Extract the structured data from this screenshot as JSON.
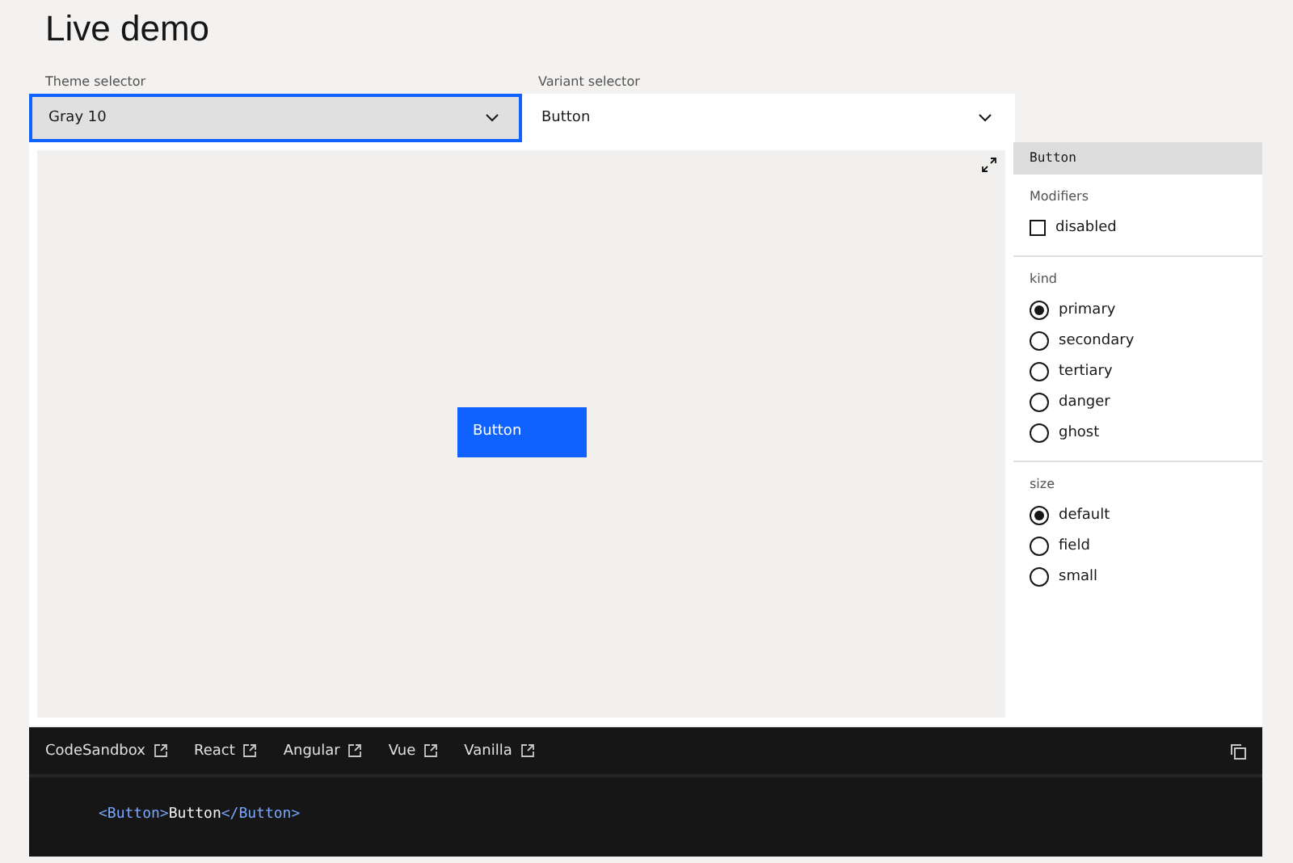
{
  "title": "Live demo",
  "theme_selector": {
    "label": "Theme selector",
    "value": "Gray 10",
    "focused": true
  },
  "variant_selector": {
    "label": "Variant selector",
    "value": "Button",
    "focused": false
  },
  "preview": {
    "button_label": "Button"
  },
  "knobs": {
    "title": "Button",
    "groups": [
      {
        "kind": "checkbox",
        "label": "Modifiers",
        "options": [
          {
            "label": "disabled",
            "checked": false
          }
        ]
      },
      {
        "kind": "radio",
        "label": "kind",
        "options": [
          {
            "label": "primary",
            "selected": true
          },
          {
            "label": "secondary",
            "selected": false
          },
          {
            "label": "tertiary",
            "selected": false
          },
          {
            "label": "danger",
            "selected": false
          },
          {
            "label": "ghost",
            "selected": false
          }
        ]
      },
      {
        "kind": "radio",
        "label": "size",
        "options": [
          {
            "label": "default",
            "selected": true
          },
          {
            "label": "field",
            "selected": false
          },
          {
            "label": "small",
            "selected": false
          }
        ]
      }
    ]
  },
  "code": {
    "tabs": [
      {
        "label": "CodeSandbox"
      },
      {
        "label": "React"
      },
      {
        "label": "Angular"
      },
      {
        "label": "Vue"
      },
      {
        "label": "Vanilla"
      }
    ],
    "tokens": [
      {
        "kind": "tag",
        "text": "<Button>"
      },
      {
        "kind": "text",
        "text": "Button"
      },
      {
        "kind": "tag",
        "text": "</Button>"
      }
    ]
  }
}
